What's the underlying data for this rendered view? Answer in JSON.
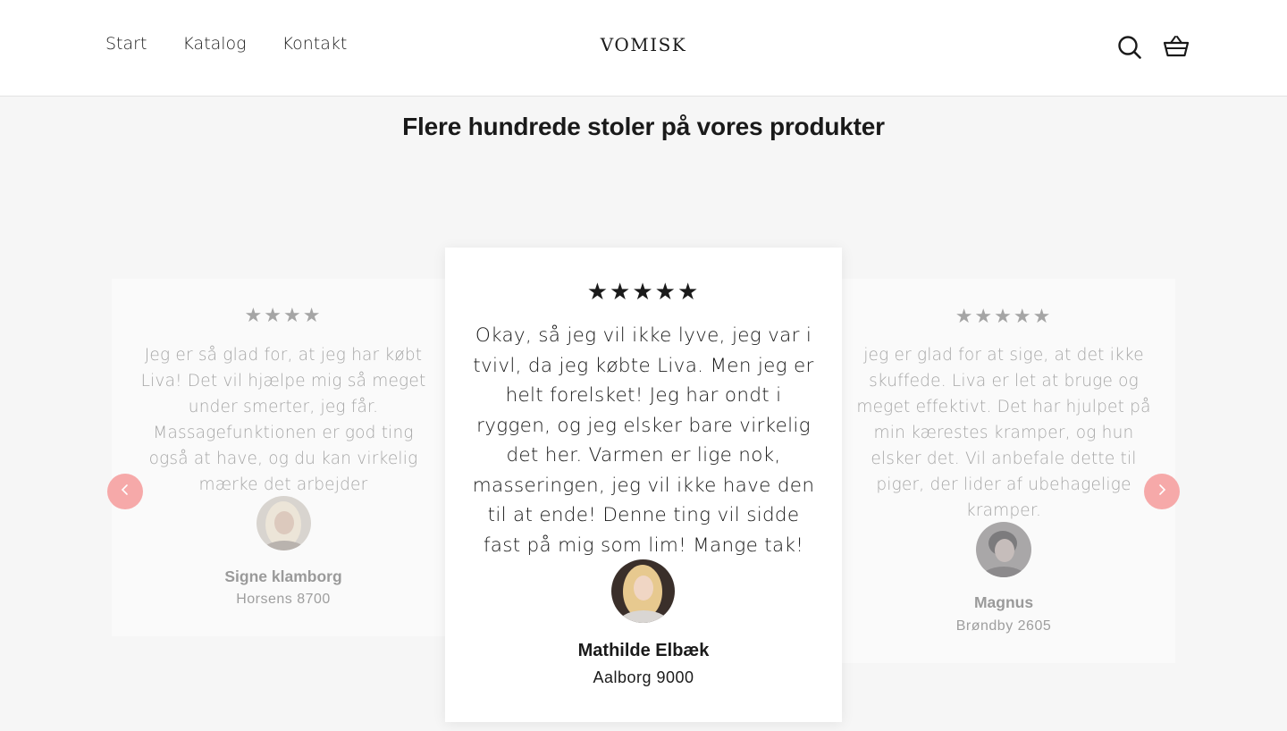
{
  "header": {
    "nav": [
      "Start",
      "Katalog",
      "Kontakt"
    ],
    "logo": "VOMISK",
    "icons": {
      "search": "search-icon",
      "cart": "basket-icon"
    }
  },
  "section": {
    "title": "Flere hundrede stoler på vores produkter"
  },
  "reviews": [
    {
      "stars": "★★★★",
      "quote": "Jeg er så glad for, at jeg har købt Liva! Det vil hjælpe mig så meget under smerter, jeg får. Massagefunktionen er god ting også at have, og du kan virkelig mærke det arbejder",
      "name": "Signe klamborg",
      "city": "Horsens 8700"
    },
    {
      "stars": "★★★★★",
      "quote": "Okay, så jeg vil ikke lyve, jeg var i tvivl, da jeg købte Liva. Men jeg er helt forelsket! Jeg har ondt i ryggen, og jeg elsker bare virkelig det her. Varmen er lige nok, masseringen, jeg vil ikke have den til at ende! Denne ting vil sidde fast på mig som lim! Mange tak!",
      "name": "Mathilde Elbæk",
      "city": "Aalborg 9000"
    },
    {
      "stars": "★★★★★",
      "quote": "jeg er glad for at sige, at det ikke skuffede. Liva er let at bruge og meget effektivt. Det har hjulpet på min kærestes kramper, og hun elsker det. Vil anbefale dette til piger, der lider af ubehagelige kramper.",
      "name": "Magnus",
      "city": "Brøndby 2605"
    }
  ],
  "carousel": {
    "prev_icon": "chevron-left-icon",
    "next_icon": "chevron-right-icon",
    "arrow_color": "#f6a9a9"
  }
}
